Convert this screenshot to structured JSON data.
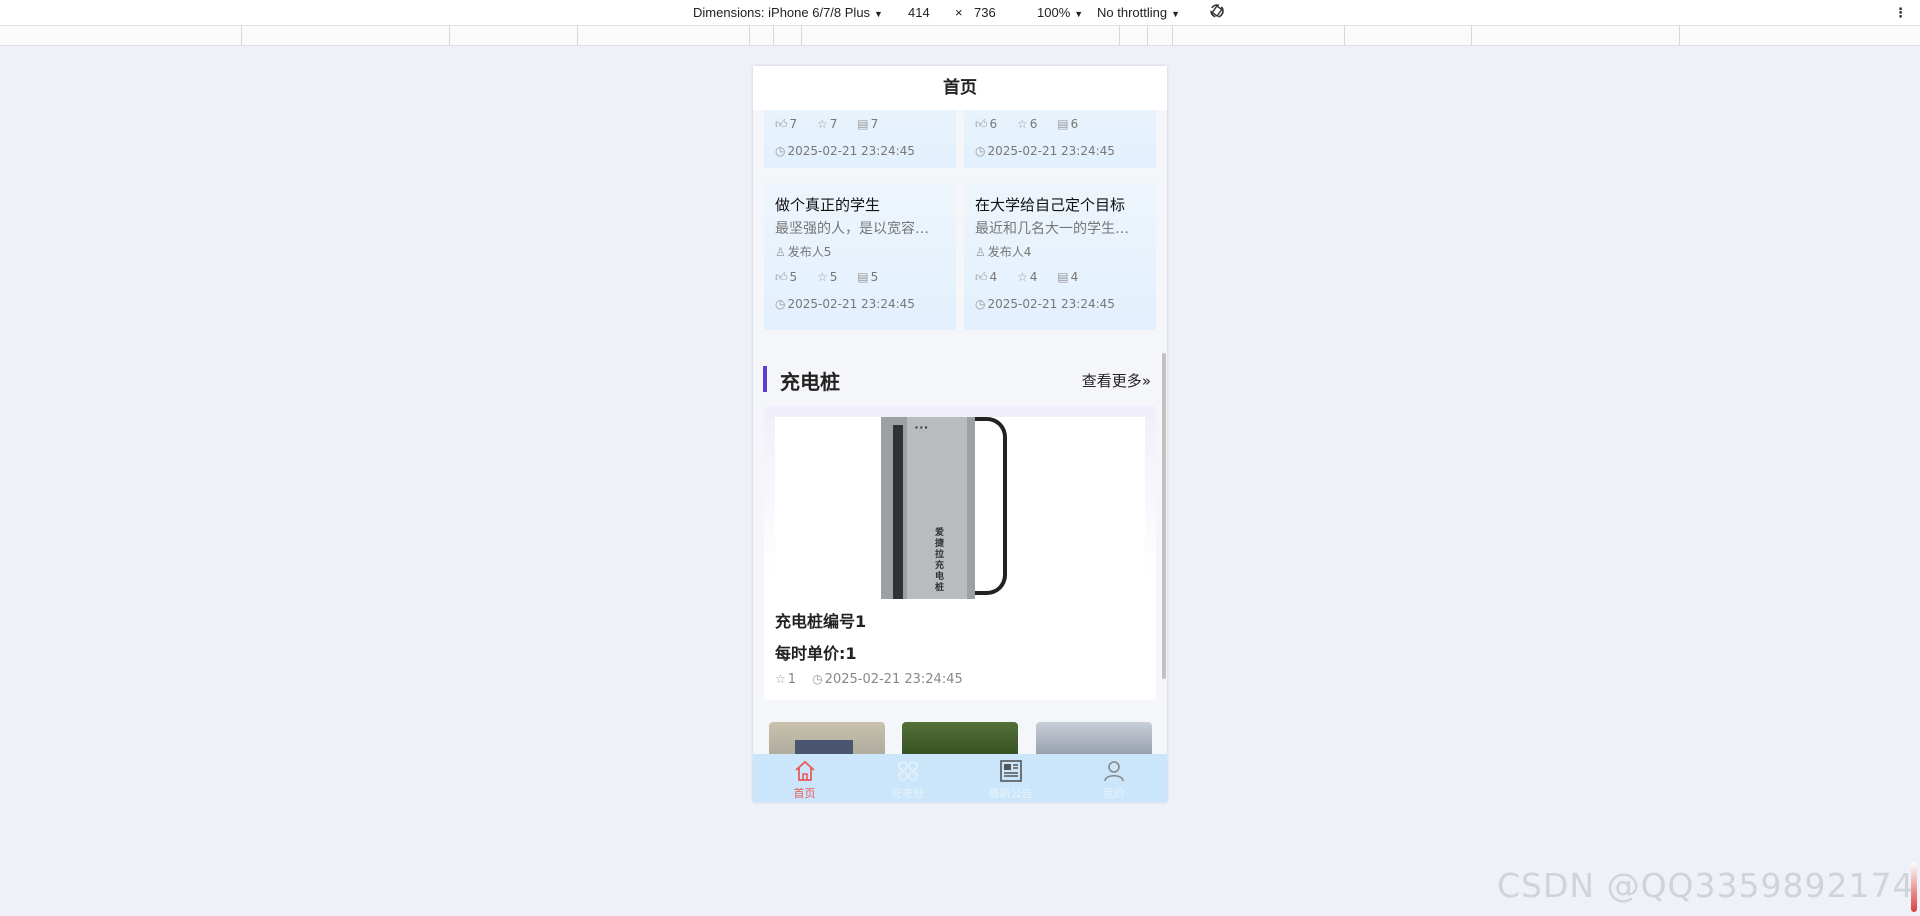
{
  "devtools": {
    "device": "Dimensions: iPhone 6/7/8 Plus",
    "width": "414",
    "times": "×",
    "height": "736",
    "zoom": "100%",
    "throttle": "No throttling",
    "menu_icon": "⋮"
  },
  "header": {
    "title": "首页"
  },
  "cards_top": [
    {
      "likes": "7",
      "stars": "7",
      "comments": "7",
      "time": "2025-02-21 23:24:45"
    },
    {
      "likes": "6",
      "stars": "6",
      "comments": "6",
      "time": "2025-02-21 23:24:45"
    }
  ],
  "cards": [
    {
      "title": "做个真正的学生",
      "desc": "最坚强的人，是以宽容…",
      "publisher": "发布人5",
      "likes": "5",
      "stars": "5",
      "comments": "5",
      "time": "2025-02-21 23:24:45"
    },
    {
      "title": "在大学给自己定个目标",
      "desc": "最近和几名大一的学生…",
      "publisher": "发布人4",
      "likes": "4",
      "stars": "4",
      "comments": "4",
      "time": "2025-02-21 23:24:45"
    }
  ],
  "section": {
    "title": "充电桩",
    "more": "查看更多",
    "more_icon": "»"
  },
  "product": {
    "name": "充电桩编号1",
    "price": "每时单价:1",
    "stars": "1",
    "time": "2025-02-21 23:24:45",
    "image_text": "爱捷拉充电桩"
  },
  "tabbar": [
    {
      "label": "首页",
      "icon": "home-icon"
    },
    {
      "label": "充电桩",
      "icon": "grid-icon"
    },
    {
      "label": "最新公告",
      "icon": "news-icon"
    },
    {
      "label": "我的",
      "icon": "user-icon"
    }
  ],
  "watermark": "CSDN @QQ3359892174",
  "colors": {
    "accent": "#5b3fd3",
    "tab_active": "#e75a5a",
    "tabbar_bg": "#cbe6fa"
  }
}
